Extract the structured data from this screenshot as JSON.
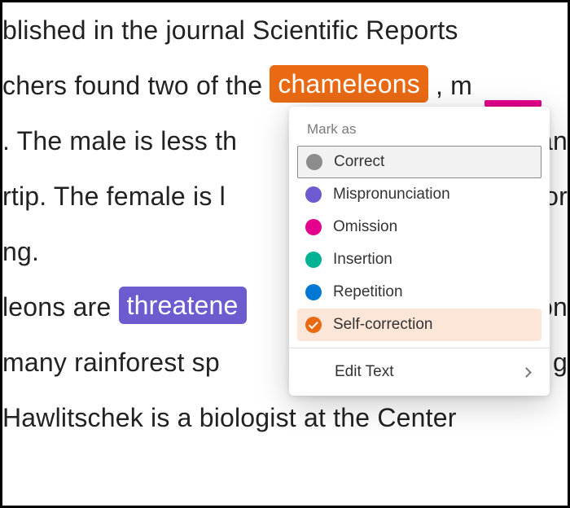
{
  "text": {
    "l1a": "blished in the journal Scientific Reports",
    "l2a": "chers found two of the ",
    "l2hl": "chameleons",
    "l2b": ", m",
    "l3a": ". The male is less th",
    "l3b": "an",
    "l4a": "rtip. The female is l",
    "l4b": "nor",
    "l5a": "ng.",
    "l6a": "leons are ",
    "l6hl": "threatene",
    "l6b": "ion",
    "l7a": "many rainforest sp",
    "l7b": "s g",
    "l8a": "Hawlitschek is a biologist at the Center"
  },
  "popup": {
    "title": "Mark as",
    "items": [
      {
        "label": "Correct",
        "colorClass": "dot-grey",
        "state": "outlined"
      },
      {
        "label": "Mispronunciation",
        "colorClass": "dot-purple",
        "state": ""
      },
      {
        "label": "Omission",
        "colorClass": "dot-pink",
        "state": ""
      },
      {
        "label": "Insertion",
        "colorClass": "dot-teal",
        "state": ""
      },
      {
        "label": "Repetition",
        "colorClass": "dot-blue",
        "state": ""
      },
      {
        "label": "Self-correction",
        "colorClass": "dot-orange",
        "state": "selected"
      }
    ],
    "editText": "Edit Text"
  },
  "colors": {
    "orange": "#ea6a14",
    "purple": "#6d5bd0",
    "pink": "#e3008c",
    "teal": "#00b294",
    "blue": "#0078d4",
    "grey": "#8c8c8c"
  }
}
